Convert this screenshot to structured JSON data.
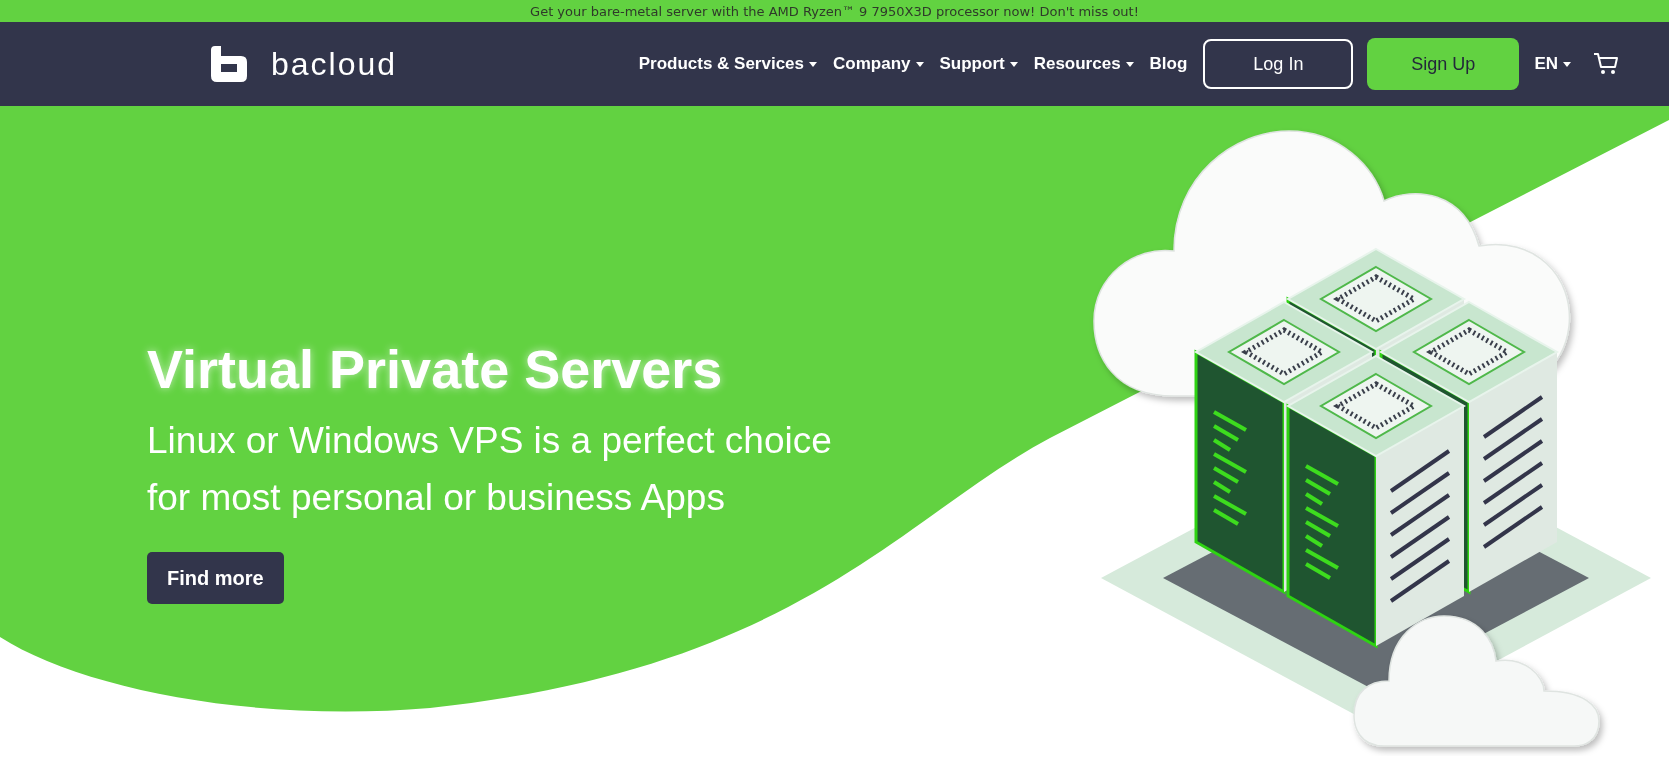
{
  "promo_banner": {
    "text": "Get your bare-metal server with the AMD Ryzen™ 9 7950X3D processor now! Don't miss out!"
  },
  "header": {
    "logo": {
      "text": "bacloud"
    },
    "nav": [
      {
        "label": "Products & Services",
        "has_dropdown": true
      },
      {
        "label": "Company",
        "has_dropdown": true
      },
      {
        "label": "Support",
        "has_dropdown": true
      },
      {
        "label": "Resources",
        "has_dropdown": true
      },
      {
        "label": "Blog",
        "has_dropdown": false
      }
    ],
    "login": "Log In",
    "signup": "Sign Up",
    "language": {
      "label": "EN",
      "has_dropdown": true
    }
  },
  "hero": {
    "title": "Virtual Private Servers",
    "subtitle": "Linux or Windows VPS is a perfect choice for most personal or business Apps",
    "button": "Find more"
  }
}
